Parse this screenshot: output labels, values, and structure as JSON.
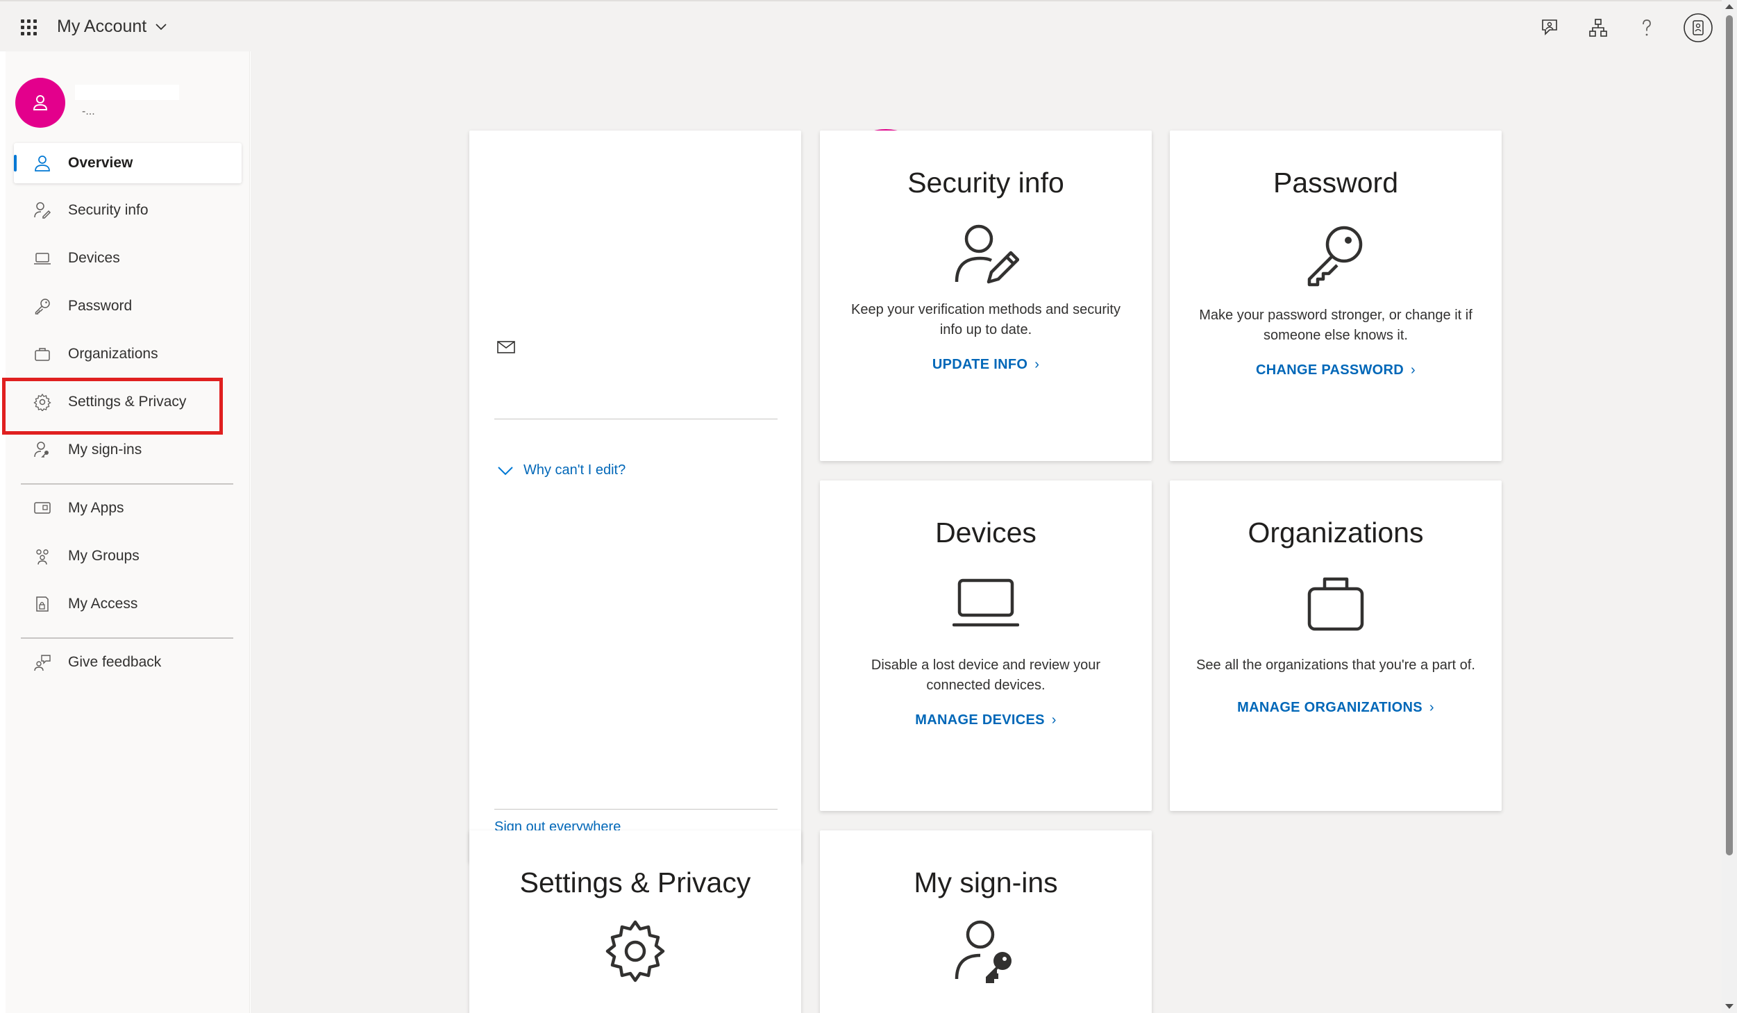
{
  "header": {
    "app_title": "My Account",
    "icons": [
      "feedback-icon",
      "org-chart-icon",
      "help-icon",
      "account-badge-icon"
    ]
  },
  "sidebar": {
    "profile_sub": "-...",
    "items": [
      {
        "label": "Overview",
        "icon": "person-icon",
        "active": true
      },
      {
        "label": "Security info",
        "icon": "security-info-icon"
      },
      {
        "label": "Devices",
        "icon": "laptop-icon"
      },
      {
        "label": "Password",
        "icon": "key-icon"
      },
      {
        "label": "Organizations",
        "icon": "briefcase-icon"
      },
      {
        "label": "Settings & Privacy",
        "icon": "gear-icon",
        "highlighted": true
      },
      {
        "label": "My sign-ins",
        "icon": "sign-ins-icon"
      },
      {
        "label": "My Apps",
        "icon": "apps-icon"
      },
      {
        "label": "My Groups",
        "icon": "groups-icon"
      },
      {
        "label": "My Access",
        "icon": "access-icon"
      },
      {
        "label": "Give feedback",
        "icon": "feedback-icon"
      }
    ]
  },
  "profile_card": {
    "why_cant_edit": "Why can't I edit?",
    "sign_out": "Sign out everywhere"
  },
  "cards": {
    "security": {
      "title": "Security info",
      "desc": "Keep your verification methods and security info up to date.",
      "link": "UPDATE INFO"
    },
    "password": {
      "title": "Password",
      "desc": "Make your password stronger, or change it if someone else knows it.",
      "link": "CHANGE PASSWORD"
    },
    "devices": {
      "title": "Devices",
      "desc": "Disable a lost device and review your connected devices.",
      "link": "MANAGE DEVICES"
    },
    "organizations": {
      "title": "Organizations",
      "desc": "See all the organizations that you're a part of.",
      "link": "MANAGE ORGANIZATIONS"
    },
    "settings": {
      "title": "Settings & Privacy"
    },
    "signins": {
      "title": "My sign-ins"
    }
  },
  "colors": {
    "accent": "#0078d4",
    "link": "#0067b8",
    "avatar": "#e3008c",
    "highlight": "#e02020"
  }
}
